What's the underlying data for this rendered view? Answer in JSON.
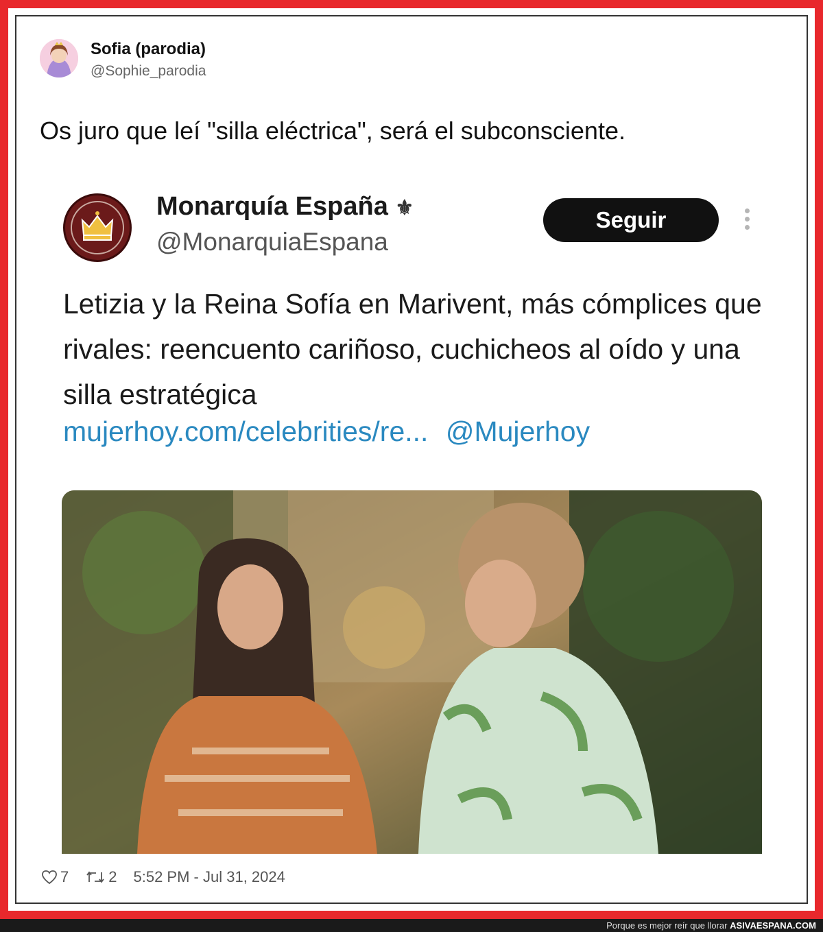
{
  "tweet": {
    "author_name": "Sofia (parodia)",
    "author_handle": "@Sophie_parodia",
    "text": "Os juro que leí \"silla eléctrica\", será el subconsciente.",
    "likes": "7",
    "retweets": "2",
    "timestamp": "5:52 PM - Jul 31, 2024"
  },
  "quoted": {
    "name": "Monarquía España",
    "name_icon": "fleur-de-lis-icon",
    "handle": "@MonarquiaEspana",
    "follow_label": "Seguir",
    "text": "Letizia y la Reina Sofía en Marivent, más cómplices que rivales: reencuento cariñoso, cuchicheos al oído y una silla estratégica",
    "link": "mujerhoy.com/celebrities/re...",
    "mention": "@Mujerhoy"
  },
  "footer": {
    "tagline": "Porque es mejor reír que llorar",
    "brand": "ASIVAESPANA.COM"
  },
  "colors": {
    "frame": "#e8282c",
    "link": "#2a89c0",
    "button": "#111111"
  }
}
